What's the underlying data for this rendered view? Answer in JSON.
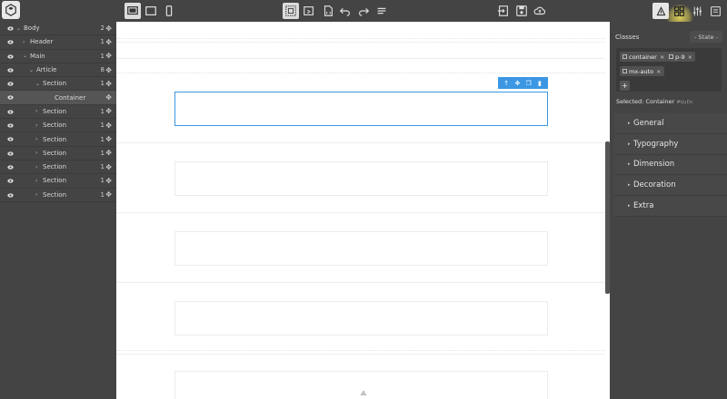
{
  "topbar": {
    "device_icons": [
      "desktop-icon",
      "tablet-icon",
      "mobile-icon"
    ],
    "action_icons": [
      "grid-outline-icon",
      "preview-icon",
      "code-file-icon",
      "undo-icon",
      "redo-icon",
      "clear-icon"
    ],
    "file_icons": [
      "import-icon",
      "save-icon",
      "cloud-upload-icon"
    ],
    "panel_icons": [
      "style-manager-icon",
      "blocks-icon",
      "settings-icon",
      "layer-manager-icon"
    ]
  },
  "layers": [
    {
      "name": "Body",
      "count": "2",
      "indent": 0,
      "caret": "open"
    },
    {
      "name": "Header",
      "count": "1",
      "indent": 1,
      "caret": "closed"
    },
    {
      "name": "Main",
      "count": "1",
      "indent": 1,
      "caret": "open"
    },
    {
      "name": "Article",
      "count": "8",
      "indent": 2,
      "caret": "open"
    },
    {
      "name": "Section",
      "count": "1",
      "indent": 3,
      "caret": "open"
    },
    {
      "name": "Container",
      "count": "",
      "indent": 4,
      "caret": "none",
      "selected": true
    },
    {
      "name": "Section",
      "count": "1",
      "indent": 3,
      "caret": "closed"
    },
    {
      "name": "Section",
      "count": "1",
      "indent": 3,
      "caret": "closed"
    },
    {
      "name": "Section",
      "count": "1",
      "indent": 3,
      "caret": "closed"
    },
    {
      "name": "Section",
      "count": "1",
      "indent": 3,
      "caret": "closed"
    },
    {
      "name": "Section",
      "count": "1",
      "indent": 3,
      "caret": "closed"
    },
    {
      "name": "Section",
      "count": "1",
      "indent": 3,
      "caret": "closed"
    },
    {
      "name": "Section",
      "count": "1",
      "indent": 3,
      "caret": "closed"
    }
  ],
  "rpanel": {
    "classes_label": "Classes",
    "state_label": "- State -",
    "tags": [
      "container",
      "p-9",
      "mx-auto"
    ],
    "add_label": "+",
    "selected_prefix": "Selected:",
    "selected_name": "Container",
    "selected_id": "#ijuDc",
    "sectors": [
      "General",
      "Typography",
      "Dimension",
      "Decoration",
      "Extra"
    ]
  },
  "colors": {
    "panel_bg": "#444444",
    "accent_blue": "#3b97e3",
    "highlight": "#f5e65a"
  }
}
